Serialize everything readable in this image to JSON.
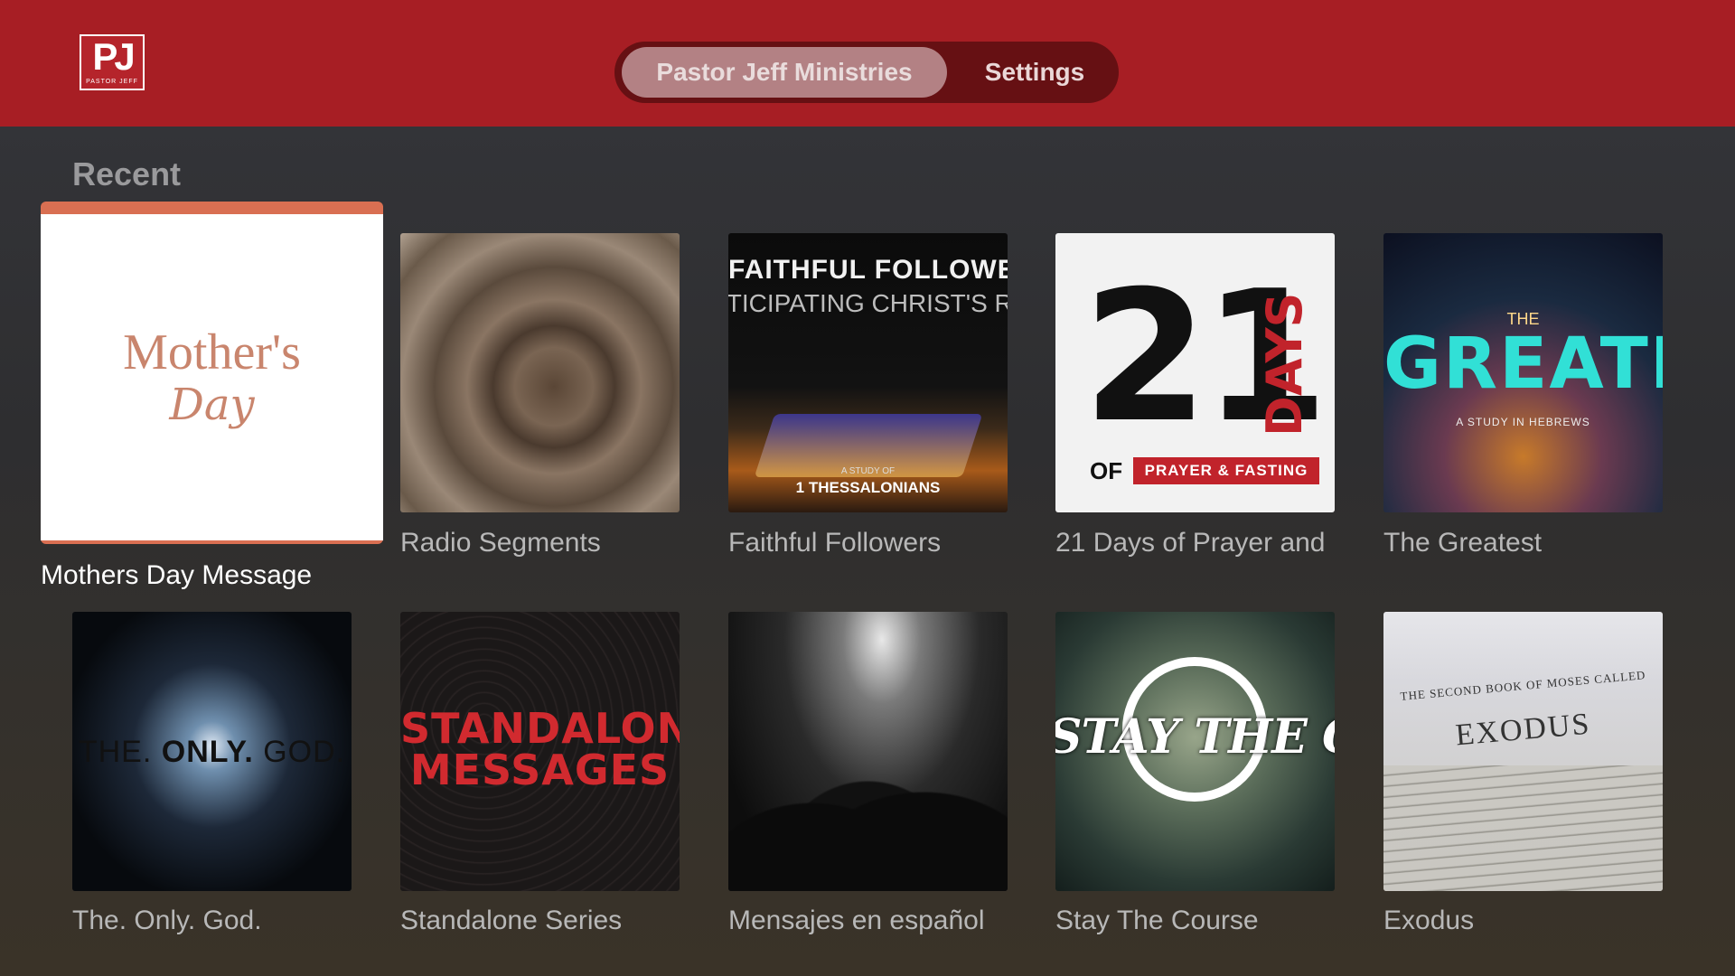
{
  "app": {
    "logo_text": "PJ",
    "logo_subtext": "PASTOR JEFF"
  },
  "tabs": [
    {
      "label": "Pastor Jeff Ministries",
      "active": true
    },
    {
      "label": "Settings",
      "active": false
    }
  ],
  "section": {
    "title": "Recent"
  },
  "items": [
    {
      "caption": "Mothers Day Message",
      "focused": true,
      "art": {
        "line1": "Mother's",
        "line2": "Day"
      }
    },
    {
      "caption": "Radio Segments"
    },
    {
      "caption": "Faithful Followers",
      "art": {
        "line1": "FAITHFUL FOLLOWEI",
        "line2": "ITICIPATING CHRIST'S RE",
        "line3": "A STUDY OF",
        "line4": "1 THESSALONIANS"
      }
    },
    {
      "caption": "21 Days of Prayer and",
      "art": {
        "number": "21",
        "word": "DAYS",
        "of": "OF",
        "banner": "PRAYER & FASTING"
      }
    },
    {
      "caption": "The Greatest",
      "art": {
        "small": "THE",
        "big": "GREATEST",
        "sub": "A STUDY IN HEBREWS"
      }
    },
    {
      "caption": "The. Only. God.",
      "art": {
        "a": "THE.",
        "b": "ONLY.",
        "c": "GOD."
      }
    },
    {
      "caption": "Standalone Series",
      "art": {
        "line1": "STANDALONE",
        "line2": "MESSAGES"
      }
    },
    {
      "caption": "Mensajes en español"
    },
    {
      "caption": "Stay The Course",
      "art": {
        "text": "STAY THE COURSE"
      }
    },
    {
      "caption": "Exodus",
      "art": {
        "header": "THE SECOND BOOK OF MOSES CALLED",
        "title": "EXODUS"
      }
    }
  ],
  "colors": {
    "topbar": "#a71e24",
    "accent": "#d96f52",
    "tab_active": "#b38184"
  }
}
